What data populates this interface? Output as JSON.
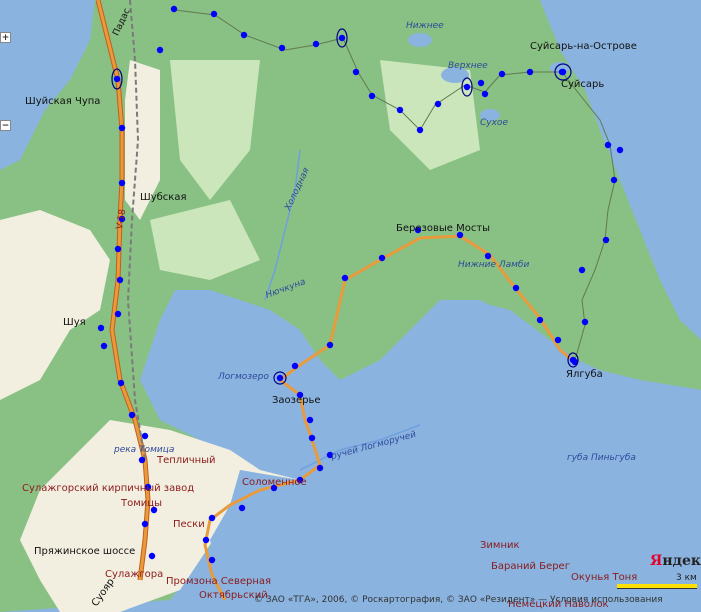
{
  "colors": {
    "water": "#8ab3e0",
    "forest": "#89c184",
    "clearing": "#dcefc8",
    "urban": "#f2efe0",
    "road": "#e89b3c",
    "route_point": "#0000ff"
  },
  "labels": {
    "passazh": "Падас",
    "nizhnee": "Нижнее",
    "suisar_na_ostrove": "Суйсарь-на-Острове",
    "verkhnee": "Верхнее",
    "suisar": "Суйсарь",
    "shuyskaya_chupa": "Шуйская Чупа",
    "sukhoe": "Сухое",
    "shubskaya": "Шубская",
    "kholodnaya": "Холодная",
    "road_v18": "V-18",
    "berezovye_mosty": "Березовые Мосты",
    "nizhnie_lambi": "Нижние Ламби",
    "nyuchkuna": "Нючкуна",
    "shuya": "Шуя",
    "logmozero": "Логмозеро",
    "zaozerye": "Заозерье",
    "yalguba": "Ялгуба",
    "ruchey_logmoruchey": "ручей Логморучей",
    "reka_tomitsa": "река Томица",
    "teplichny": "Тепличный",
    "sulazhgorsky_zavod": "Сулажгорский кирпичный завод",
    "solomennoe": "Соломенное",
    "tomitsy": "Томицы",
    "guba_pinguba": "губа Пиньгуба",
    "peski": "Пески",
    "pryazhinskoe_shosse": "Пряжинское шоссе",
    "zimnik": "Зимник",
    "baraniy_bereg": "Бараний Берег",
    "okunya_tonya": "Окунья Тоня",
    "sulazhgora": "Сулажгора",
    "promzona": "Промзона Северная",
    "oktyabrsky": "Октябрьский",
    "nemetsky_navolok": "Немецкий Наволок",
    "suoyarvi_partial": "Суояр"
  },
  "controls": {
    "zoom_in": "+",
    "zoom_out": "−"
  },
  "branding": {
    "logo": "Яндекс",
    "scale": "3 км",
    "copyright": "© ЗАО «ТГА», 2006, © Роскартография, © ЗАО «Резидент» — Условия использования"
  }
}
